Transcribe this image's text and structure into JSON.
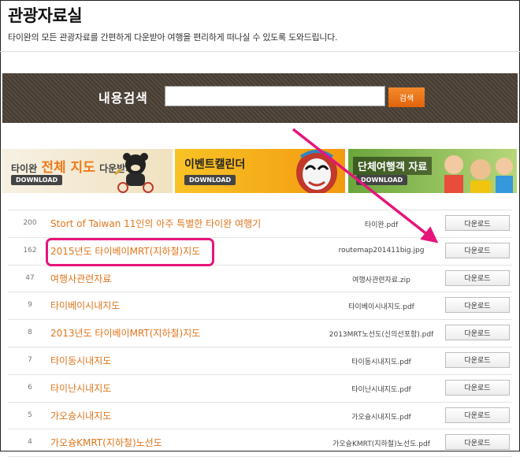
{
  "header": {
    "title": "관광자료실",
    "subtitle": "타이완의 모든 관광자료를 간편하게 다운받아 여행을 편리하게 떠나실 수 있도록 도와드립니다."
  },
  "search": {
    "label": "내용검색",
    "value": "",
    "button_label": "검색"
  },
  "banners": [
    {
      "pre": "타이완",
      "highlight": "전체 지도",
      "post": "다운받기",
      "badge": "DOWNLOAD"
    },
    {
      "text": "이벤트캘린더",
      "badge": "DOWNLOAD"
    },
    {
      "text": "단체여행객 자료",
      "badge": "DOWNLOAD"
    }
  ],
  "files": [
    {
      "count": "200",
      "name": "Stort of Taiwan 11인의 아주 특별한 타이완 여행기",
      "file": "타이완.pdf",
      "button": "다운로드"
    },
    {
      "count": "162",
      "name": "2015년도 타이베이MRT(지하철)지도",
      "file": "routemap201411big.jpg",
      "button": "다운로드"
    },
    {
      "count": "47",
      "name": "여행사관련자료",
      "file": "여행사관련자료.zip",
      "button": "다운로드"
    },
    {
      "count": "9",
      "name": "타이베이시내지도",
      "file": "타이베이시내지도.pdf",
      "button": "다운로드"
    },
    {
      "count": "8",
      "name": "2013년도 타이베이MRT(지하철)지도",
      "file": "2013MRT노선도(신의선포함).pdf",
      "button": "다운로드"
    },
    {
      "count": "7",
      "name": "타이동시내지도",
      "file": "타이동시내지도.pdf",
      "button": "다운로드"
    },
    {
      "count": "6",
      "name": "타이난시내지도",
      "file": "타이난시내지도.pdf",
      "button": "다운로드"
    },
    {
      "count": "5",
      "name": "가오슝시내지도",
      "file": "가오슝시내지도.pdf",
      "button": "다운로드"
    },
    {
      "count": "4",
      "name": "가오슝KMRT(지하철)노선도",
      "file": "가오슝KMRT(지하철)노선도.pdf",
      "button": "다운로드"
    }
  ],
  "annotation": {
    "highlight_color": "#e6157a",
    "highlighted_row_index": 1,
    "arrow_points_to": "download-button row 2"
  },
  "colors": {
    "accent_orange": "#e0761d",
    "search_bar_bg": "#4a4035",
    "search_button": "#ef7a1c"
  }
}
